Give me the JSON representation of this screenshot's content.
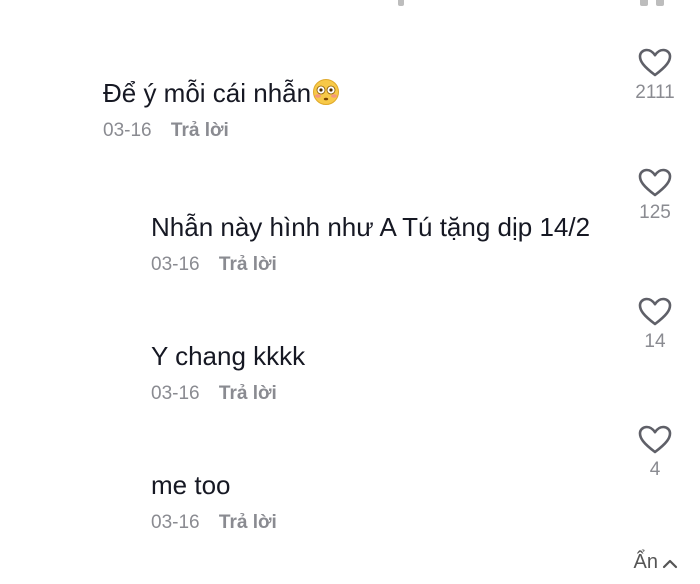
{
  "comments": [
    {
      "text": "Để ý mỗi cái nhẫn",
      "emoji": "flushed-face-emoji",
      "date": "03-16",
      "reply": "Trả lời",
      "likes": "2111"
    },
    {
      "text": "Nhẫn này hình như A Tú tặng dịp 14/2",
      "date": "03-16",
      "reply": "Trả lời",
      "likes": "125"
    },
    {
      "text": "Y chang kkkk",
      "date": "03-16",
      "reply": "Trả lời",
      "likes": "14"
    },
    {
      "text": "me too",
      "date": "03-16",
      "reply": "Trả lời",
      "likes": "4"
    }
  ],
  "hide_label": "Ẩn",
  "icons": {
    "like": "heart-outline-icon",
    "hide": "chevron-up-icon"
  },
  "colors": {
    "text": "#161823",
    "muted": "#8a8b91"
  }
}
